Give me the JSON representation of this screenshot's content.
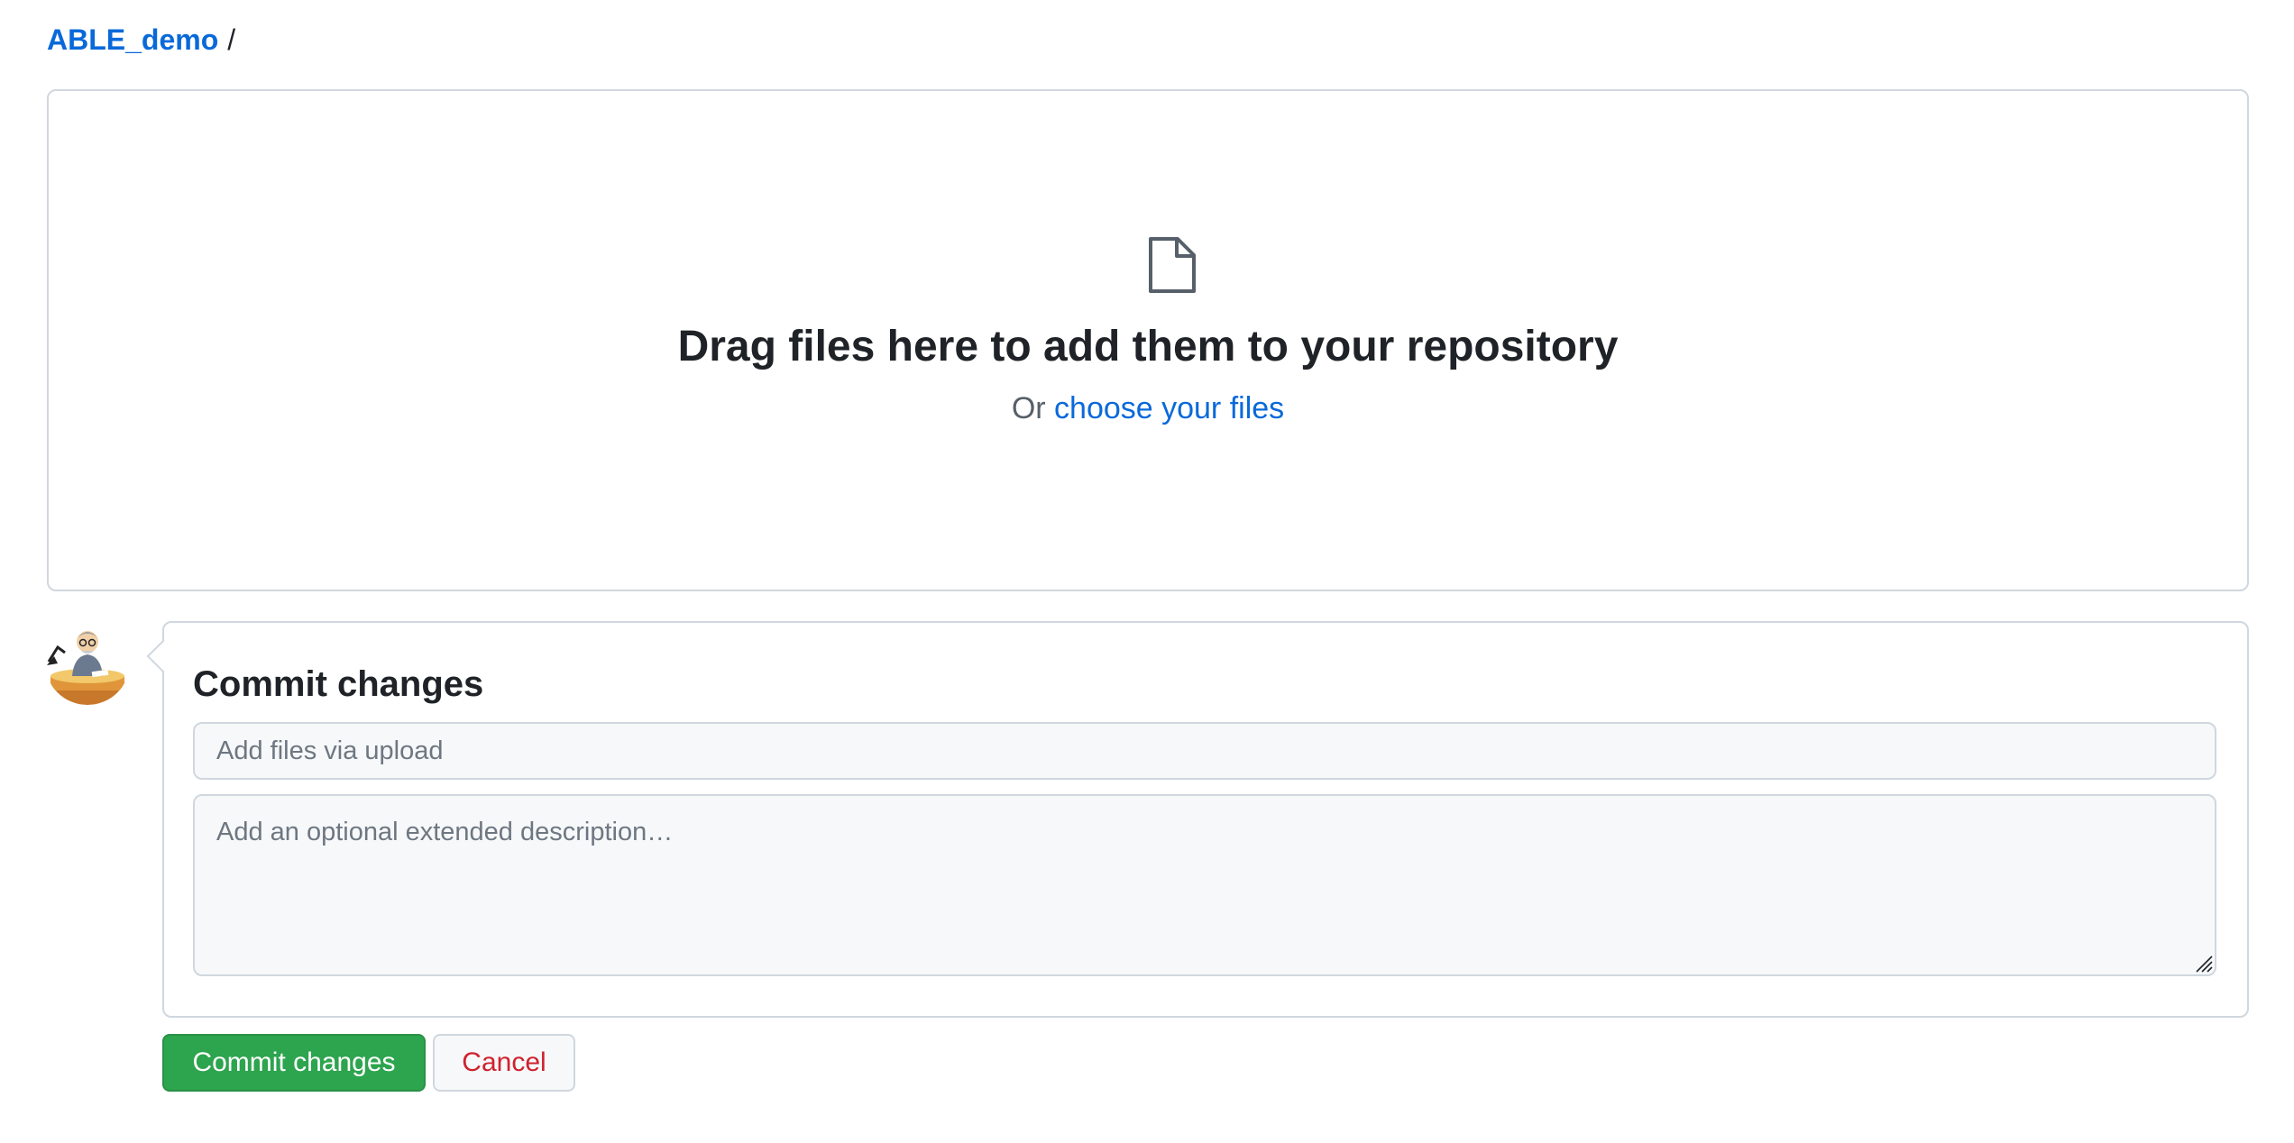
{
  "breadcrumb": {
    "repo": "ABLE_demo",
    "separator": "/"
  },
  "dropzone": {
    "icon": "file-icon",
    "title": "Drag files here to add them to your repository",
    "sub_prefix": "Or ",
    "choose_link": "choose your files"
  },
  "avatar": {
    "icon": "user-avatar"
  },
  "commit": {
    "title": "Commit changes",
    "summary_placeholder": "Add files via upload",
    "description_placeholder": "Add an optional extended description…"
  },
  "buttons": {
    "commit_label": "Commit changes",
    "cancel_label": "Cancel"
  },
  "colors": {
    "link": "#0969da",
    "primary_button": "#2da44e",
    "danger_text": "#cf222e",
    "border": "#d0d7de",
    "input_bg": "#f6f8fa"
  }
}
